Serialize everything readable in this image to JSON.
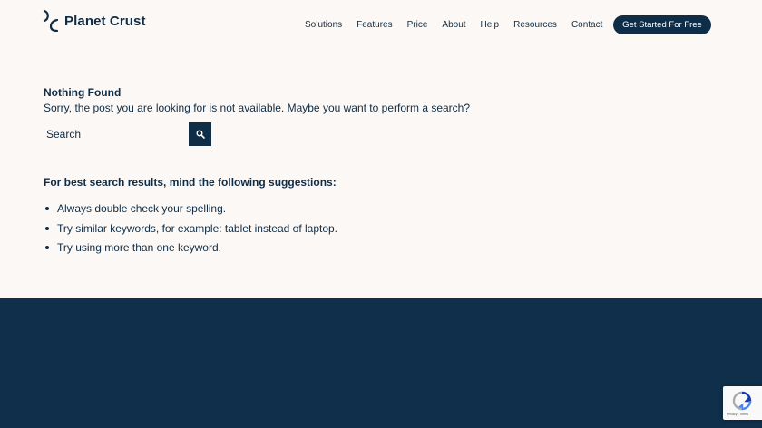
{
  "header": {
    "brand": "Planet Crust",
    "nav": [
      "Solutions",
      "Features",
      "Price",
      "About",
      "Help",
      "Resources",
      "Contact"
    ],
    "cta": "Get Started For Free"
  },
  "main": {
    "title": "Nothing Found",
    "message": "Sorry, the post you are looking for is not available. Maybe you want to perform a search?",
    "search": {
      "placeholder": "Search",
      "button_icon": "search-icon"
    },
    "tips_title": "For best search results, mind the following suggestions:",
    "tips": [
      "Always double check your spelling.",
      "Try similar keywords, for example: tablet instead of laptop.",
      "Try using more than one keyword."
    ]
  },
  "recaptcha": {
    "terms": "Privacy - Terms",
    "icon": "recaptcha-icon"
  },
  "colors": {
    "background": "#fcf8f5",
    "text": "#0f2d47",
    "footer": "#0f2f4b"
  }
}
